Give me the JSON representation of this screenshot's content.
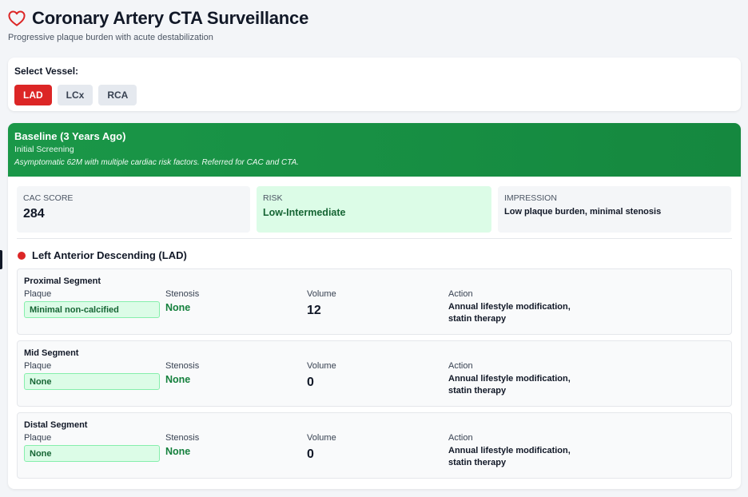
{
  "header": {
    "title": "Coronary Artery CTA Surveillance",
    "subtitle": "Progressive plaque burden with acute destabilization",
    "icon": "heart-icon",
    "icon_color": "#dc2626"
  },
  "vessel_selector": {
    "label": "Select Vessel:",
    "options": [
      "LAD",
      "LCx",
      "RCA"
    ],
    "selected": "LAD",
    "active_color": "#dc2626"
  },
  "study": {
    "title": "Baseline (3 Years Ago)",
    "subtitle": "Initial Screening",
    "note": "Asymptomatic 62M with multiple cardiac risk factors. Referred for CAC and CTA.",
    "banner_color": "#16a34a",
    "summary": {
      "cac_label": "CAC SCORE",
      "cac_value": "284",
      "risk_label": "RISK",
      "risk_value": "Low-Intermediate",
      "impression_label": "IMPRESSION",
      "impression_value": "Low plaque burden, minimal stenosis"
    }
  },
  "vessel_detail": {
    "name": "Left Anterior Descending (LAD)",
    "column_labels": {
      "plaque": "Plaque",
      "stenosis": "Stenosis",
      "volume": "Volume",
      "action": "Action"
    },
    "segments": [
      {
        "title": "Proximal Segment",
        "plaque": "Minimal non-calcified",
        "stenosis": "None",
        "volume": "12",
        "action_line1": "Annual lifestyle modification,",
        "action_line2": "statin therapy"
      },
      {
        "title": "Mid Segment",
        "plaque": "None",
        "stenosis": "None",
        "volume": "0",
        "action_line1": "Annual lifestyle modification,",
        "action_line2": "statin therapy"
      },
      {
        "title": "Distal Segment",
        "plaque": "None",
        "stenosis": "None",
        "volume": "0",
        "action_line1": "Annual lifestyle modification,",
        "action_line2": "statin therapy"
      }
    ]
  }
}
